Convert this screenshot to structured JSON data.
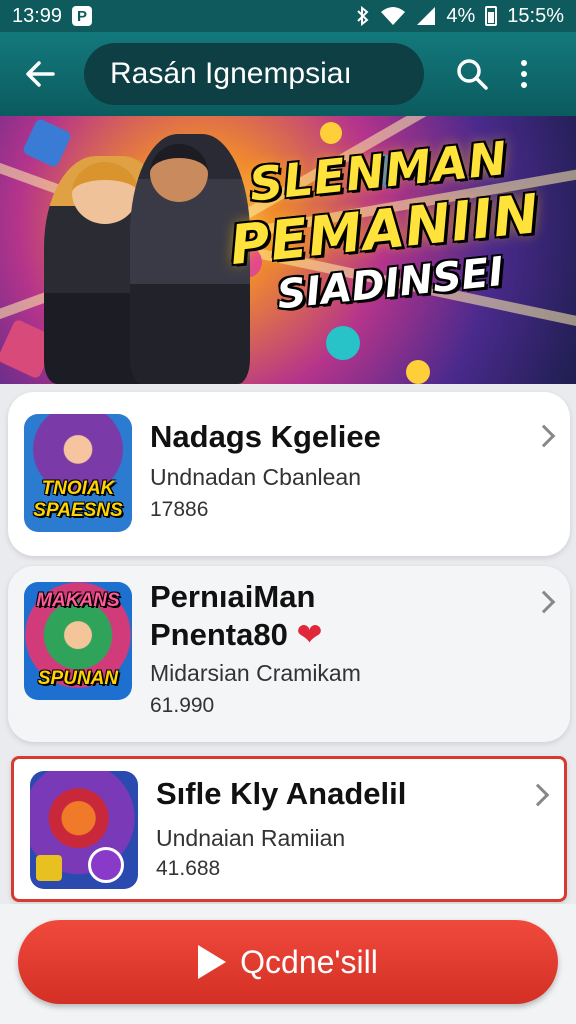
{
  "status_bar": {
    "time_left": "13:99",
    "badge": "P",
    "battery_text": "4%",
    "time_right": "15:5%"
  },
  "app_bar": {
    "title": "Rasán Ignempsiaı",
    "icons": [
      "back-arrow-icon",
      "search-icon",
      "more-vert-icon"
    ]
  },
  "banner": {
    "line1": "SLENMAN",
    "line2": "PEMANIIN",
    "line3": "SIADINSEI"
  },
  "games": [
    {
      "title": "Nadags Kgeliee",
      "subtitle": "Undnadan Cbanlean",
      "count": "17886",
      "thumb_text": "TNOIAK SPAESNS"
    },
    {
      "title_line1": "PernıaiMan",
      "title_line2": "Pnenta80",
      "heart": "❤",
      "subtitle": "Midarsian Cramikam",
      "count": "61.990",
      "thumb_text_top": "MAKANS",
      "thumb_text_bottom": "SPUNAN"
    },
    {
      "title": "Sıfle Kly Anadelil",
      "subtitle": "Undnaian Ramiian",
      "count": "41.688"
    }
  ],
  "primary_button": {
    "label": "Qcdne'sill"
  },
  "colors": {
    "appbar": "#13797c",
    "accent_red": "#d42f24",
    "selected_border": "#d43c32"
  }
}
